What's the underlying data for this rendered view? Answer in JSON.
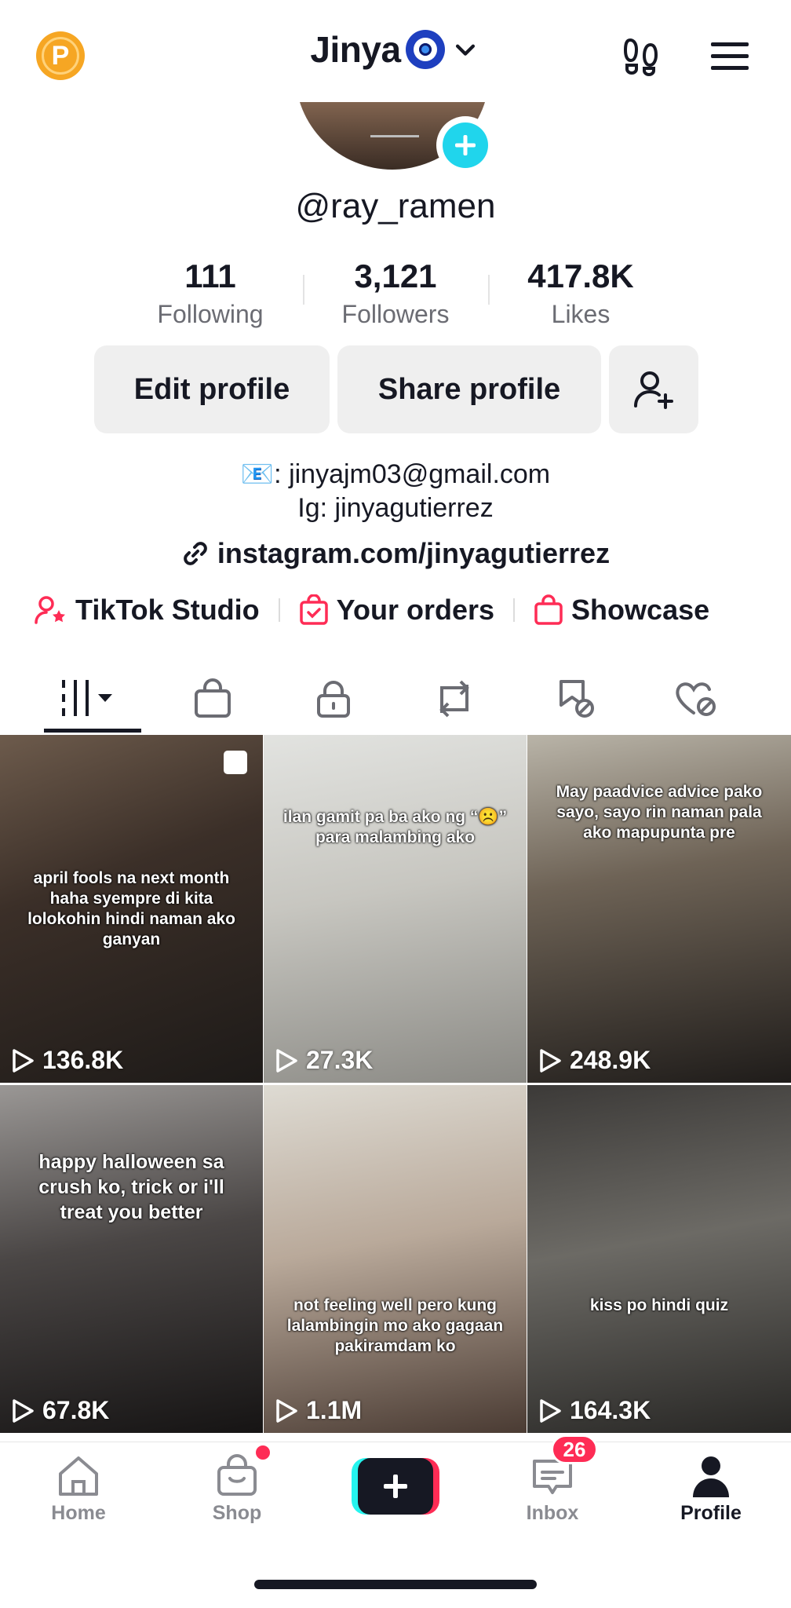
{
  "header": {
    "coin_label": "P",
    "title": "Jinya",
    "icons": [
      "coin-icon",
      "evil-eye-icon",
      "chevron-down-icon",
      "footprints-icon",
      "menu-icon"
    ]
  },
  "profile": {
    "username": "@ray_ramen",
    "stats": [
      {
        "value": "111",
        "label": "Following"
      },
      {
        "value": "3,121",
        "label": "Followers"
      },
      {
        "value": "417.8K",
        "label": "Likes"
      }
    ],
    "edit_label": "Edit profile",
    "share_label": "Share profile",
    "bio_line1": "📧: jinyajm03@gmail.com",
    "bio_line2": "Ig: jinyagutierrez",
    "link": "instagram.com/jinyagutierrez"
  },
  "quick_links": [
    {
      "label": "TikTok Studio",
      "icon": "creator-icon"
    },
    {
      "label": "Your orders",
      "icon": "orders-icon"
    },
    {
      "label": "Showcase",
      "icon": "showcase-icon"
    }
  ],
  "tabs": [
    "videos-grid-icon",
    "shop-bag-icon",
    "private-lock-icon",
    "repost-icon",
    "favorites-icon",
    "liked-icon"
  ],
  "videos": [
    {
      "caption": "april fools na next month haha syempre di kita lolokohin hindi naman ako ganyan",
      "views": "136.8K",
      "pinned": true
    },
    {
      "caption": "ilan gamit pa ba ako ng “☹️” para malambing ako",
      "views": "27.3K",
      "pinned": false
    },
    {
      "caption": "May paadvice advice pako sayo, sayo rin naman pala ako mapupunta pre",
      "views": "248.9K",
      "pinned": false
    },
    {
      "caption": "happy halloween sa crush ko, trick or i'll treat you better",
      "views": "67.8K",
      "pinned": false
    },
    {
      "caption": "not feeling well pero kung lalambingin mo ako gagaan pakiramdam ko",
      "views": "1.1M",
      "pinned": false
    },
    {
      "caption": "kiss po hindi quiz",
      "views": "164.3K",
      "pinned": false
    }
  ],
  "bottom_nav": {
    "home": "Home",
    "shop": "Shop",
    "inbox": "Inbox",
    "inbox_badge": "26",
    "profile": "Profile"
  },
  "colors": {
    "accent": "#fe2c55",
    "cyan": "#25f4ee",
    "text": "#161823",
    "muted": "#6b6c73"
  }
}
